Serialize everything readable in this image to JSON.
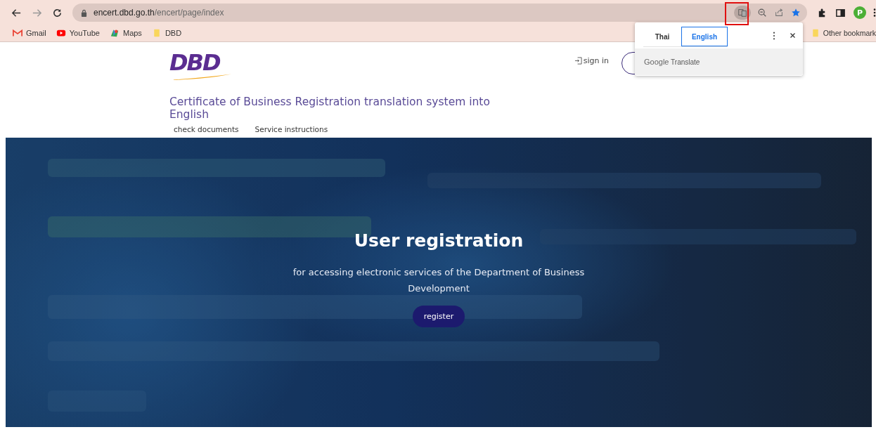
{
  "browser": {
    "url_host": "encert.dbd.go.th",
    "url_path": "/encert/page/index",
    "profile_initial": "P",
    "bookmarks": [
      {
        "label": "Gmail",
        "kind": "gmail"
      },
      {
        "label": "YouTube",
        "kind": "youtube"
      },
      {
        "label": "Maps",
        "kind": "maps"
      },
      {
        "label": "DBD",
        "kind": "folder"
      }
    ],
    "other_bookmarks": "Other bookmark"
  },
  "translate_popup": {
    "tabs": [
      {
        "label": "Thai",
        "selected": false
      },
      {
        "label": "English",
        "selected": true
      }
    ],
    "brand": "Google",
    "product": "Translate"
  },
  "header": {
    "logo": "DBD",
    "sign_in": "sign in",
    "title": "Certificate of Business Registration translation system into English",
    "nav": [
      "check documents",
      "Service instructions"
    ]
  },
  "hero": {
    "kind": "picture",
    "heading": "User registration",
    "subtitle": "for accessing electronic services of the Department of Business Development",
    "button": "register"
  }
}
